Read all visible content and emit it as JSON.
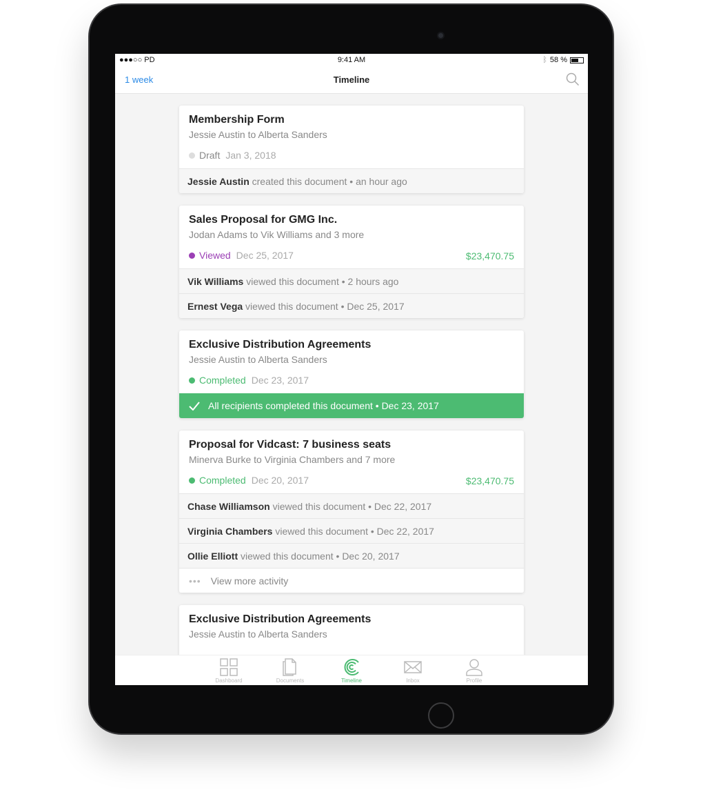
{
  "status": {
    "carrier": "●●●○○ PD",
    "time": "9:41 AM",
    "battery": "58 %"
  },
  "nav": {
    "back": "1 week",
    "title": "Timeline"
  },
  "colors": {
    "accent": "#2b8ae6",
    "green": "#4cbb72",
    "purple": "#9b3fb5",
    "draft": "#dddddd"
  },
  "cards": [
    {
      "title": "Membership Form",
      "subtitle": "Jessie Austin to Alberta Sanders",
      "status": "Draft",
      "date": "Jan 3, 2018",
      "activity": [
        {
          "name": "Jessie Austin",
          "text": " created this document • an hour ago"
        }
      ]
    },
    {
      "title": "Sales Proposal for GMG Inc.",
      "subtitle": "Jodan Adams to Vik Williams and 3 more",
      "status": "Viewed",
      "date": "Dec 25, 2017",
      "amount": "$23,470.75",
      "activity": [
        {
          "name": "Vik Williams",
          "text": " viewed this document • 2 hours ago"
        },
        {
          "name": "Ernest Vega",
          "text": " viewed this document • Dec 25, 2017"
        }
      ]
    },
    {
      "title": "Exclusive Distribution Agreements",
      "subtitle": "Jessie Austin to Alberta Sanders",
      "status": "Completed",
      "date": "Dec 23, 2017",
      "banner": "All recipients completed this document • Dec 23, 2017"
    },
    {
      "title": "Proposal for Vidcast: 7 business seats",
      "subtitle": "Minerva Burke to Virginia Chambers and 7 more",
      "status": "Completed",
      "date": "Dec 20, 2017",
      "amount": "$23,470.75",
      "activity": [
        {
          "name": "Chase Williamson",
          "text": " viewed this document • Dec 22, 2017"
        },
        {
          "name": "Virginia Chambers",
          "text": " viewed this document • Dec 22, 2017"
        },
        {
          "name": "Ollie Elliott",
          "text": " viewed this document • Dec 20, 2017"
        }
      ],
      "more": "View more activity"
    },
    {
      "title": "Exclusive Distribution Agreements",
      "subtitle": "Jessie Austin to Alberta Sanders"
    }
  ],
  "tabs": [
    {
      "label": "Dashboard",
      "icon": "grid-icon"
    },
    {
      "label": "Documents",
      "icon": "documents-icon"
    },
    {
      "label": "Timeline",
      "icon": "timeline-icon",
      "active": true
    },
    {
      "label": "Inbox",
      "icon": "envelope-icon"
    },
    {
      "label": "Profile",
      "icon": "person-icon"
    }
  ]
}
